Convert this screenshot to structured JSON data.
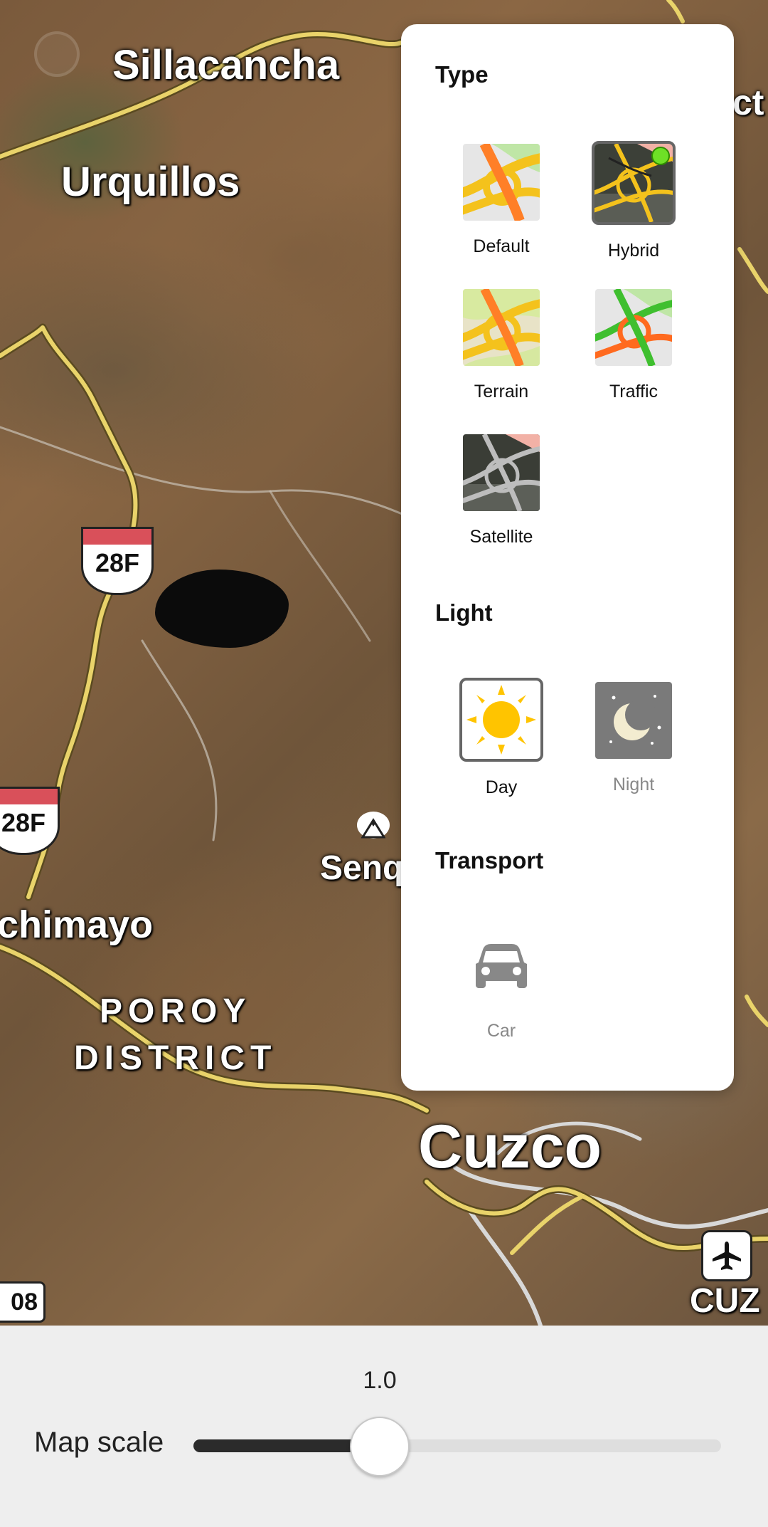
{
  "map": {
    "places": {
      "sillacancha": "Sillacancha",
      "urquillos": "Urquillos",
      "chimayo": "chimayo",
      "poroy": "POROY\nDISTRICT",
      "senq": "Senq",
      "cuzco": "Cuzco",
      "cuz": "CUZ",
      "ct": "ct"
    },
    "shields": [
      "28F",
      "28F"
    ],
    "road_box": "08",
    "icons": [
      "mountain-peak-icon",
      "airport-icon"
    ]
  },
  "panel": {
    "type_title": "Type",
    "types": [
      {
        "label": "Default",
        "selected": false,
        "icon": "default-map-thumbnail"
      },
      {
        "label": "Hybrid",
        "selected": true,
        "icon": "hybrid-map-thumbnail"
      },
      {
        "label": "Terrain",
        "selected": false,
        "icon": "terrain-map-thumbnail"
      },
      {
        "label": "Traffic",
        "selected": false,
        "icon": "traffic-map-thumbnail"
      },
      {
        "label": "Satellite",
        "selected": false,
        "icon": "satellite-map-thumbnail"
      }
    ],
    "light_title": "Light",
    "light": [
      {
        "label": "Day",
        "selected": true,
        "icon": "sun-icon"
      },
      {
        "label": "Night",
        "selected": false,
        "icon": "moon-icon"
      }
    ],
    "transport_title": "Transport",
    "transport": [
      {
        "label": "Car",
        "selected": false,
        "icon": "car-icon"
      }
    ]
  },
  "bottom": {
    "scale_value": "1.0",
    "scale_label": "Map scale",
    "slider_fraction": 0.35
  },
  "colors": {
    "selected_dot": "#6ee026",
    "road_yellow": "#e9d36a",
    "shield_red": "#d9505a"
  }
}
